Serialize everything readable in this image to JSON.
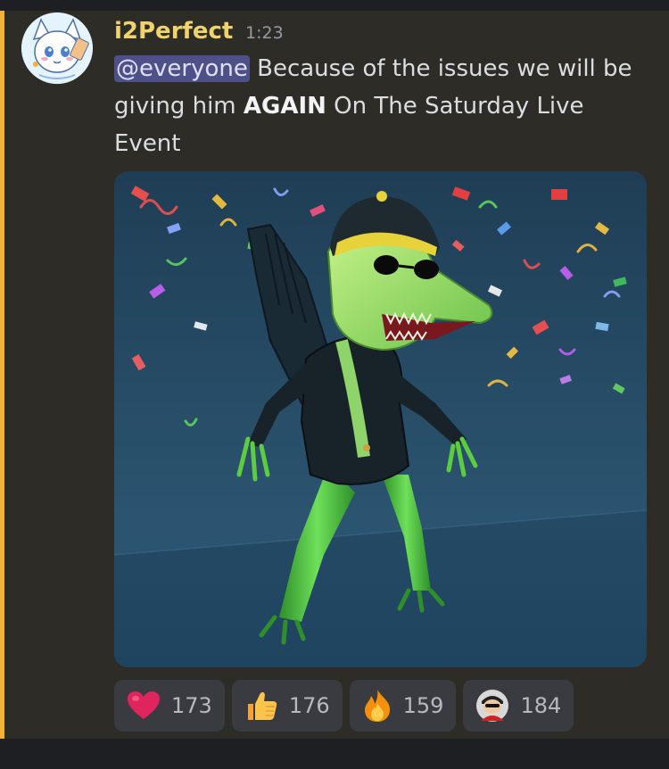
{
  "message": {
    "username": "i2Perfect",
    "timestamp": "1:23",
    "mention": "@everyone",
    "text_part1": " Because of the issues we will be giving him ",
    "text_bold": "AGAIN",
    "text_part2": " On The Saturday Live Event"
  },
  "attachment": {
    "icon": "gator-character-image"
  },
  "reactions": [
    {
      "emoji": "heart-icon",
      "count": "173"
    },
    {
      "emoji": "thumbs-up-icon",
      "count": "176"
    },
    {
      "emoji": "fire-icon",
      "count": "159"
    },
    {
      "emoji": "custom-avatar-emoji-icon",
      "count": "184"
    }
  ],
  "colors": {
    "username": "#f0d36a",
    "highlight_bar": "#f0b232",
    "mention_bg": "#4e5188",
    "background": "#2e2c27"
  }
}
